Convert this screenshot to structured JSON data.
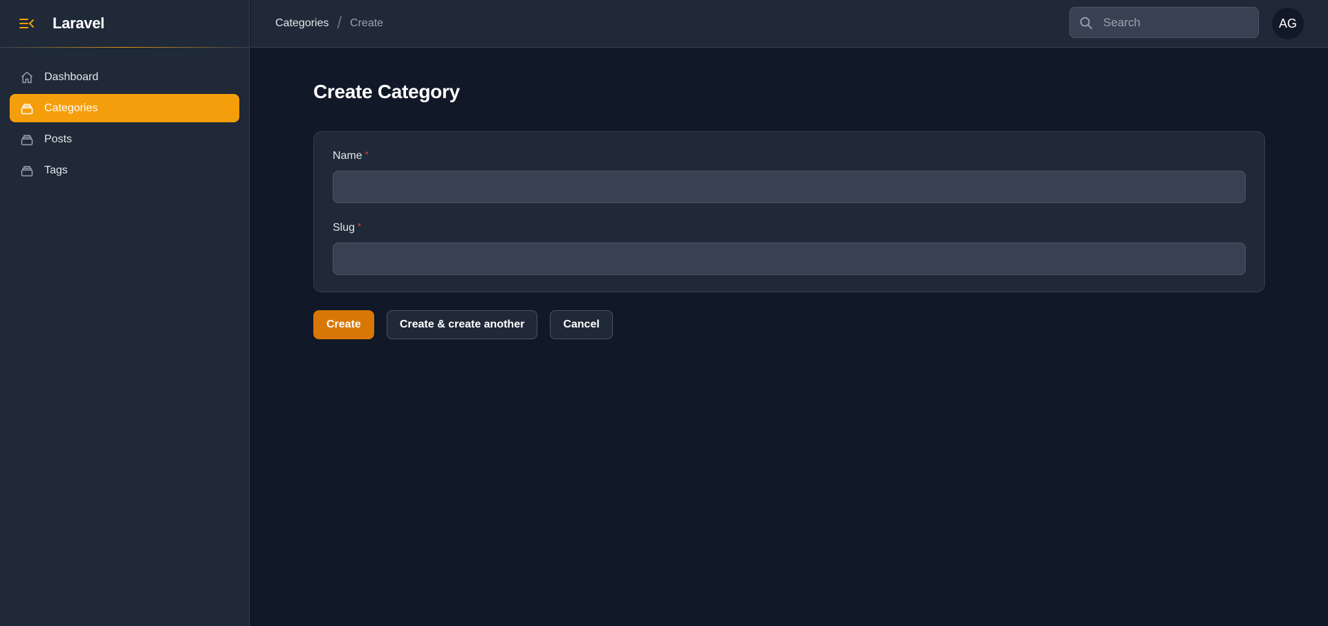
{
  "brand": {
    "title": "Laravel"
  },
  "sidebar": {
    "items": [
      {
        "label": "Dashboard",
        "icon": "home-icon",
        "active": false
      },
      {
        "label": "Categories",
        "icon": "archive-icon",
        "active": true
      },
      {
        "label": "Posts",
        "icon": "archive-icon",
        "active": false
      },
      {
        "label": "Tags",
        "icon": "archive-icon",
        "active": false
      }
    ]
  },
  "breadcrumb": {
    "items": [
      "Categories",
      "Create"
    ],
    "separator": "/"
  },
  "search": {
    "placeholder": "Search",
    "value": ""
  },
  "user": {
    "initials": "AG"
  },
  "page": {
    "title": "Create Category"
  },
  "form": {
    "fields": [
      {
        "label": "Name",
        "required": true,
        "required_marker": "*",
        "value": ""
      },
      {
        "label": "Slug",
        "required": true,
        "required_marker": "*",
        "value": ""
      }
    ]
  },
  "actions": {
    "create": "Create",
    "create_another": "Create & create another",
    "cancel": "Cancel"
  },
  "colors": {
    "accent": "#f59e0b",
    "primary_button": "#d97706",
    "background": "#111827",
    "panel": "#1f2937",
    "required": "#ef4444"
  }
}
